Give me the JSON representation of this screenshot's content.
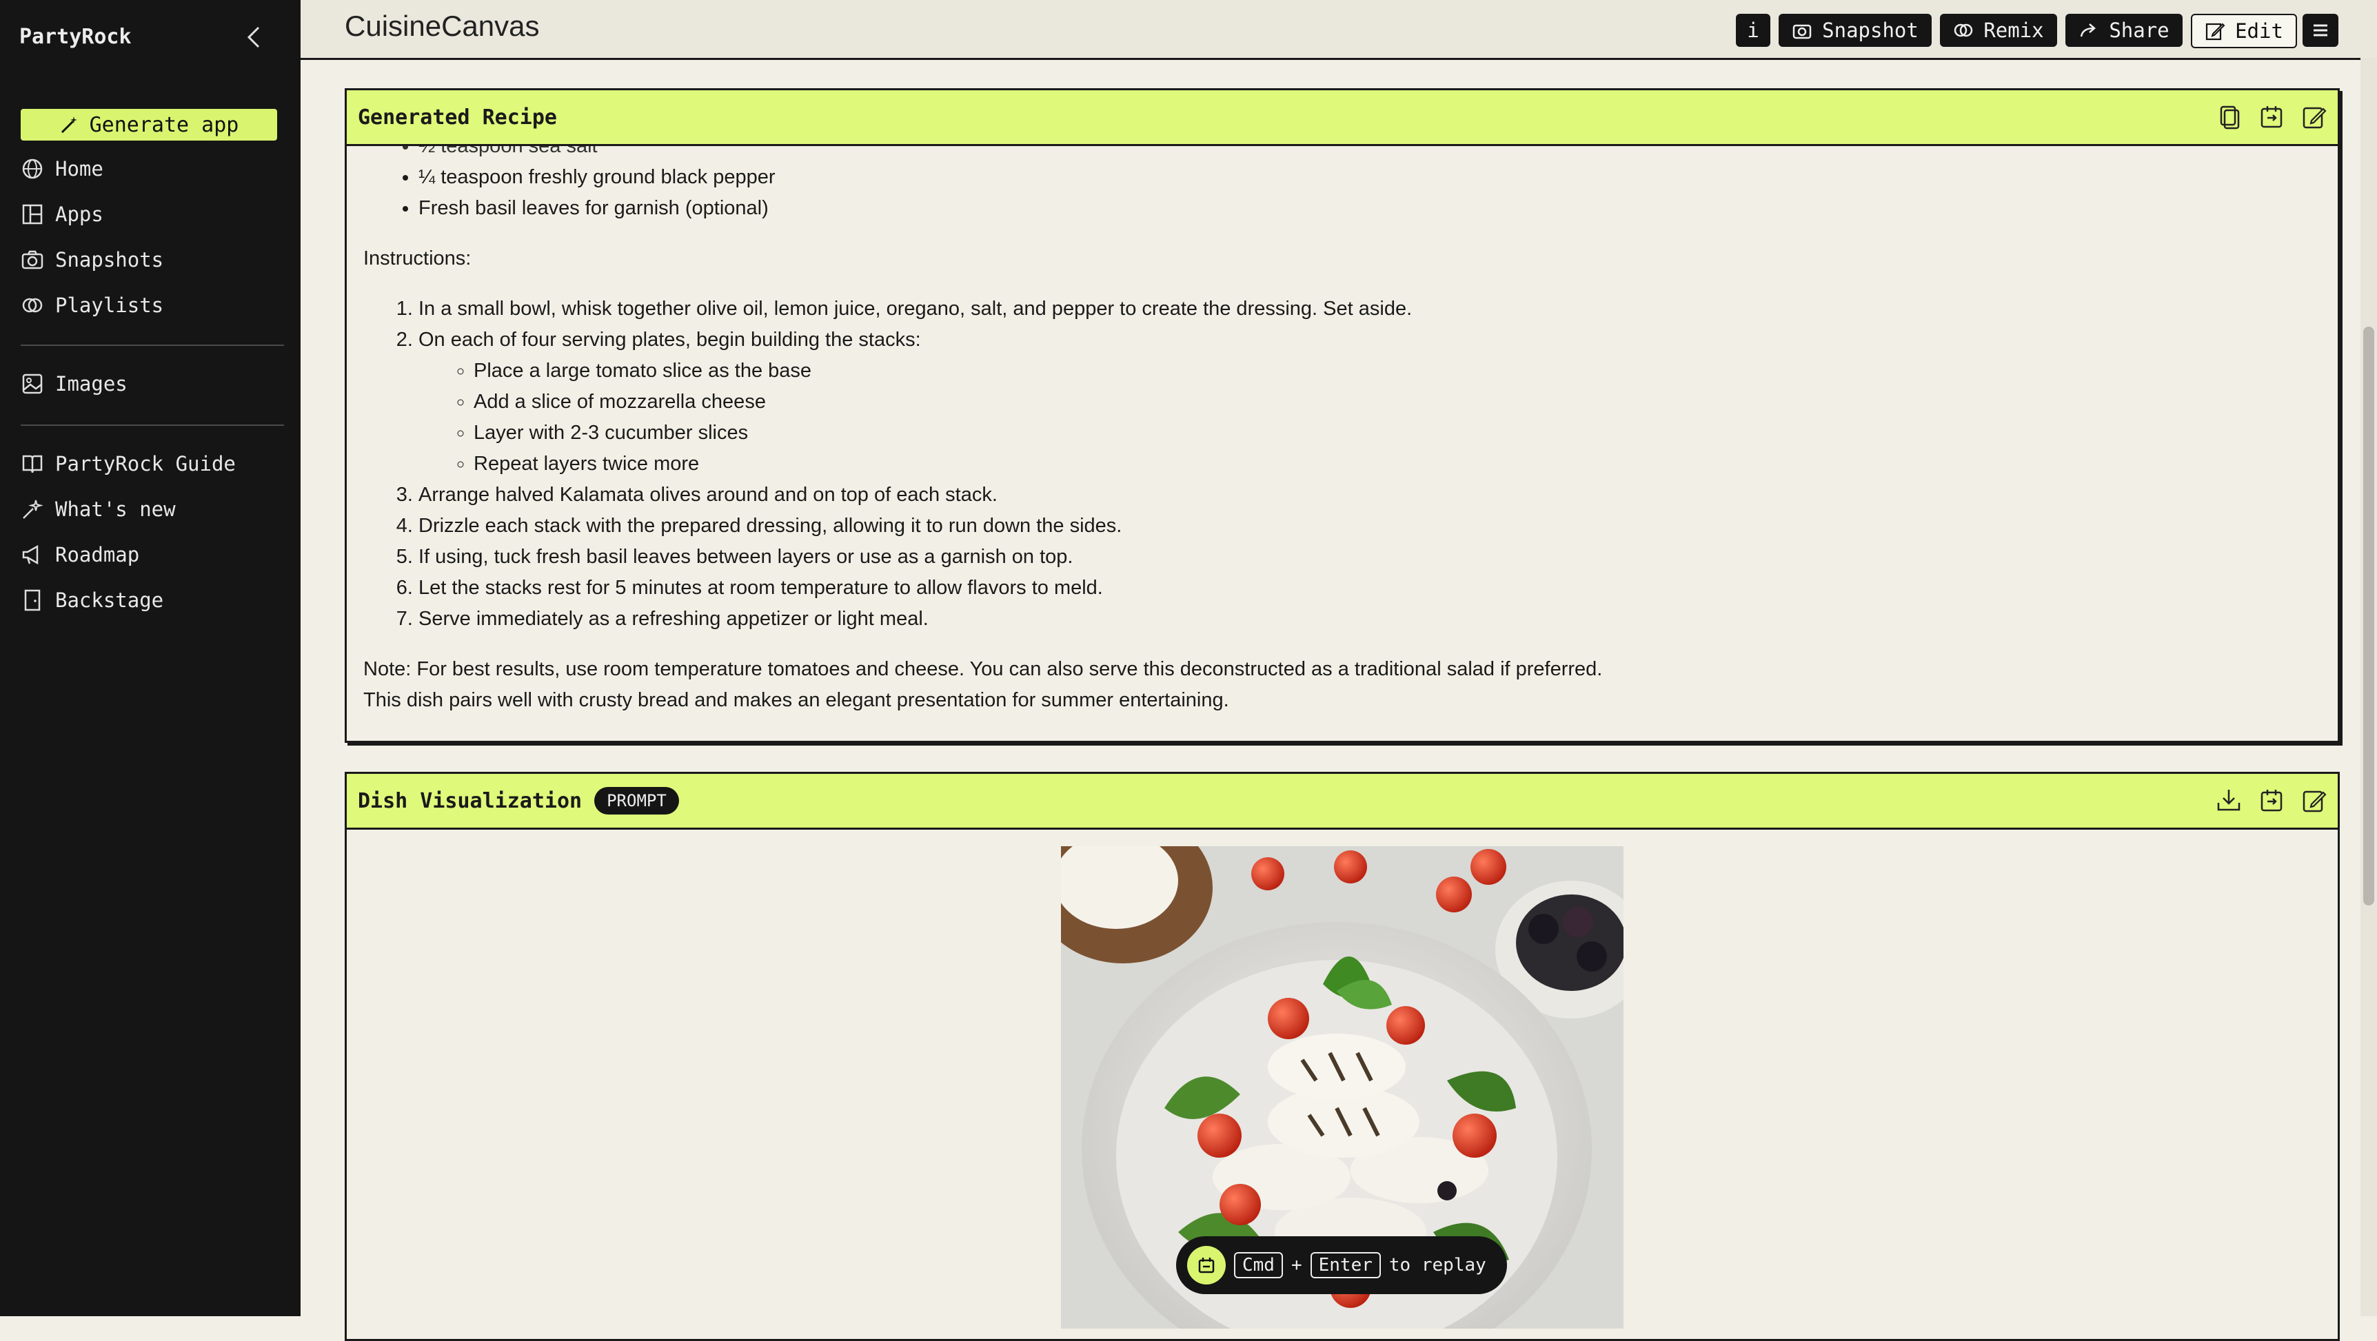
{
  "sidebar": {
    "brand": "PartyRock",
    "generate_label": "Generate app",
    "items": [
      {
        "label": "Home",
        "icon": "globe-icon"
      },
      {
        "label": "Apps",
        "icon": "apps-icon"
      },
      {
        "label": "Snapshots",
        "icon": "camera-icon"
      },
      {
        "label": "Playlists",
        "icon": "playlist-icon"
      },
      {
        "label": "Images",
        "icon": "images-icon"
      },
      {
        "label": "PartyRock Guide",
        "icon": "book-icon"
      },
      {
        "label": "What's new",
        "icon": "sparkle-icon"
      },
      {
        "label": "Roadmap",
        "icon": "megaphone-icon"
      },
      {
        "label": "Backstage",
        "icon": "door-icon"
      }
    ]
  },
  "header": {
    "app_title": "CuisineCanvas",
    "buttons": {
      "info": "i",
      "snapshot": "Snapshot",
      "remix": "Remix",
      "share": "Share",
      "edit": "Edit"
    }
  },
  "recipe_card": {
    "title": "Generated Recipe",
    "partial_line": "½ teaspoon sea salt",
    "ingredients": [
      "¼ teaspoon freshly ground black pepper",
      "Fresh basil leaves for garnish (optional)"
    ],
    "instructions_label": "Instructions:",
    "steps": [
      "In a small bowl, whisk together olive oil, lemon juice, oregano, salt, and pepper to create the dressing. Set aside.",
      "On each of four serving plates, begin building the stacks:",
      "Arrange halved Kalamata olives around and on top of each stack.",
      "Drizzle each stack with the prepared dressing, allowing it to run down the sides.",
      "If using, tuck fresh basil leaves between layers or use as a garnish on top.",
      "Let the stacks rest for 5 minutes at room temperature to allow flavors to meld.",
      "Serve immediately as a refreshing appetizer or light meal."
    ],
    "substeps": [
      "Place a large tomato slice as the base",
      "Add a slice of mozzarella cheese",
      "Layer with 2-3 cucumber slices",
      "Repeat layers twice more"
    ],
    "note_1": "Note: For best results, use room temperature tomatoes and cheese. You can also serve this deconstructed as a traditional salad if preferred.",
    "note_2": "This dish pairs well with crusty bread and makes an elegant presentation for summer entertaining."
  },
  "viz_card": {
    "title": "Dish Visualization",
    "badge": "PROMPT"
  },
  "replay_hint": {
    "key1": "Cmd",
    "plus": "+",
    "key2": "Enter",
    "text": "to replay"
  },
  "colors": {
    "accent": "#dff97a",
    "sidebar_bg": "#151515",
    "page_bg": "#f2f0e6"
  }
}
